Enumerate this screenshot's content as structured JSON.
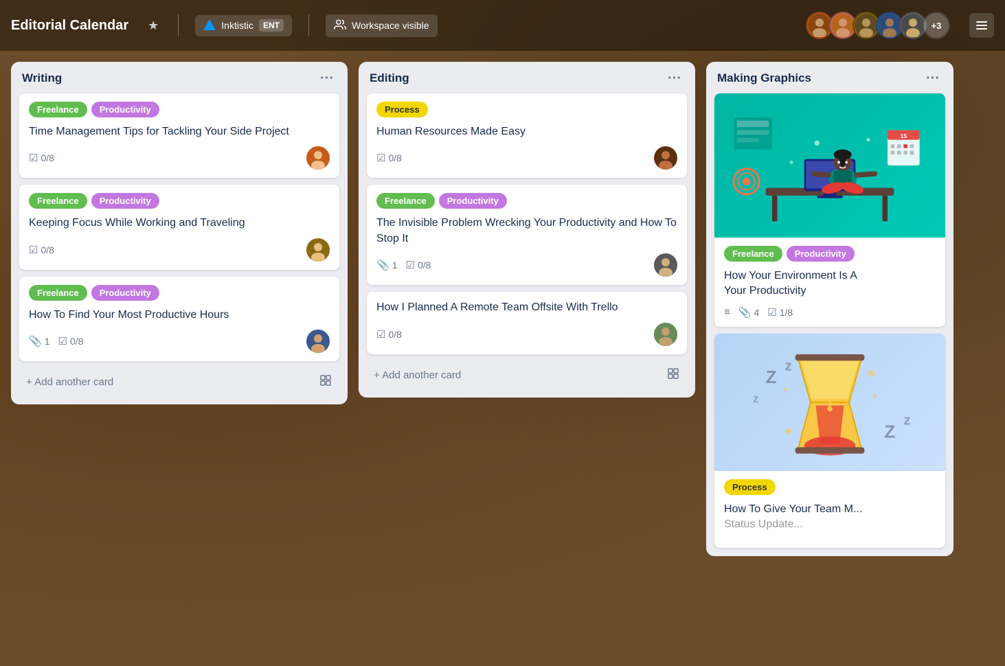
{
  "header": {
    "title": "Editorial Calendar",
    "star_label": "★",
    "workspace": {
      "logo_alt": "Inktistic logo",
      "name": "Inktistic",
      "badge": "ENT"
    },
    "visibility": {
      "icon": "👤",
      "label": "Workspace visible"
    },
    "avatars_more": "+3",
    "menu_icon": "≡"
  },
  "columns": [
    {
      "id": "writing",
      "title": "Writing",
      "menu": "···",
      "cards": [
        {
          "id": "card-1",
          "labels": [
            {
              "text": "Freelance",
              "type": "freelance"
            },
            {
              "text": "Productivity",
              "type": "productivity"
            }
          ],
          "title": "Time Management Tips for Tackling Your Side Project",
          "attachments": null,
          "checklist": "0/8",
          "avatar_class": "ca-1"
        },
        {
          "id": "card-2",
          "labels": [
            {
              "text": "Freelance",
              "type": "freelance"
            },
            {
              "text": "Productivity",
              "type": "productivity"
            }
          ],
          "title": "Keeping Focus While Working and Traveling",
          "attachments": null,
          "checklist": "0/8",
          "avatar_class": "ca-2"
        },
        {
          "id": "card-3",
          "labels": [
            {
              "text": "Freelance",
              "type": "freelance"
            },
            {
              "text": "Productivity",
              "type": "productivity"
            }
          ],
          "title": "How To Find Your Most Productive Hours",
          "attachments": "1",
          "checklist": "0/8",
          "avatar_class": "ca-3"
        }
      ],
      "add_card_label": "+ Add another card"
    },
    {
      "id": "editing",
      "title": "Editing",
      "menu": "···",
      "cards": [
        {
          "id": "card-4",
          "labels": [
            {
              "text": "Process",
              "type": "process"
            }
          ],
          "title": "Human Resources Made Easy",
          "attachments": null,
          "checklist": "0/8",
          "avatar_class": "ca-4"
        },
        {
          "id": "card-5",
          "labels": [
            {
              "text": "Freelance",
              "type": "freelance"
            },
            {
              "text": "Productivity",
              "type": "productivity"
            }
          ],
          "title": "The Invisible Problem Wrecking Your Productivity and How To Stop It",
          "attachments": "1",
          "checklist": "0/8",
          "avatar_class": "ca-5"
        },
        {
          "id": "card-6",
          "labels": [],
          "title": "How I Planned A Remote Team Offsite With Trello",
          "attachments": null,
          "checklist": "0/8",
          "avatar_class": "ca-3"
        }
      ],
      "add_card_label": "+ Add another card"
    },
    {
      "id": "making-graphics",
      "title": "Making Graphics",
      "menu": "···",
      "cards": [
        {
          "id": "card-7",
          "has_image": true,
          "image_type": "teal",
          "labels": [
            {
              "text": "Freelance",
              "type": "freelance"
            },
            {
              "text": "Productivity",
              "type": "productivity"
            }
          ],
          "title": "How Your Environment Is A Your Productivity",
          "description_icon": true,
          "attachments": "4",
          "checklist": "1/8"
        },
        {
          "id": "card-8",
          "has_image": true,
          "image_type": "blue",
          "labels": [
            {
              "text": "Process",
              "type": "process"
            }
          ],
          "title": "How To Give Your Team M... Status Update..."
        }
      ]
    }
  ],
  "labels": {
    "freelance": "Freelance",
    "productivity": "Productivity",
    "process": "Process"
  },
  "meta_icons": {
    "checklist": "☑",
    "attachment": "📎",
    "description": "≡"
  }
}
